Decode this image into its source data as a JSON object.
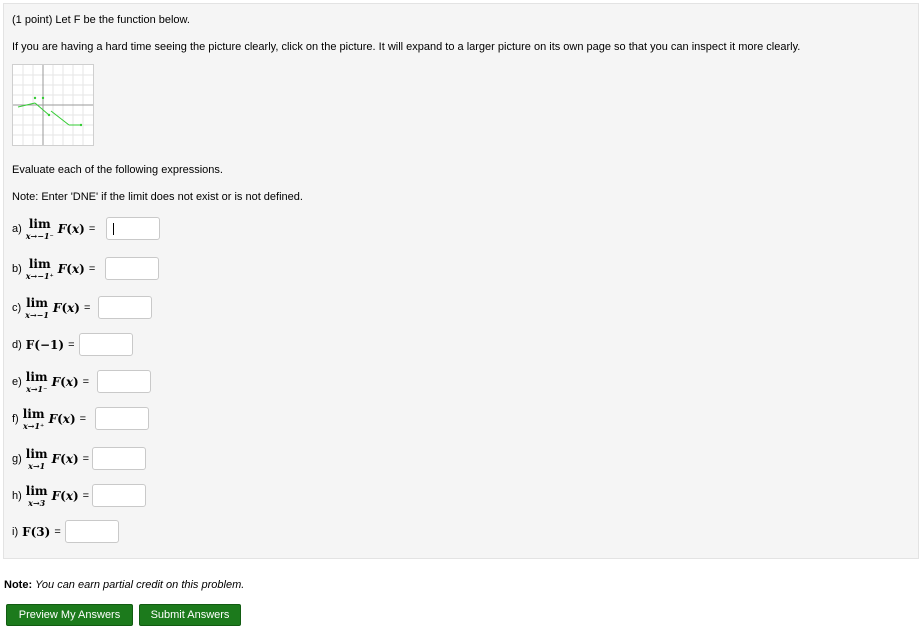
{
  "problem": {
    "header": "(1 point) Let F be the function below.",
    "picture_hint": "If you are having a hard time seeing the picture clearly, click on the picture. It will expand to a larger picture on its own page so that you can inspect it more clearly.",
    "evaluate": "Evaluate each of the following expressions.",
    "note": "Note: Enter 'DNE' if the limit does not exist or is not defined."
  },
  "questions": [
    {
      "label": "a)",
      "kind": "lim",
      "sub": "x→−1⁻",
      "f": "F",
      "var": "x",
      "value": ""
    },
    {
      "label": "b)",
      "kind": "lim",
      "sub": "x→−1⁺",
      "f": "F",
      "var": "x",
      "value": ""
    },
    {
      "label": "c)",
      "kind": "lim",
      "sub": "x→−1",
      "f": "F",
      "var": "x",
      "value": ""
    },
    {
      "label": "d)",
      "kind": "val",
      "expr": "F(−1)",
      "value": ""
    },
    {
      "label": "e)",
      "kind": "lim",
      "sub": "x→1⁻",
      "f": "F",
      "var": "x",
      "value": ""
    },
    {
      "label": "f)",
      "kind": "lim",
      "sub": "x→1⁺",
      "f": "F",
      "var": "x",
      "value": ""
    },
    {
      "label": "g)",
      "kind": "lim",
      "sub": "x→1",
      "f": "F",
      "var": "x",
      "value": ""
    },
    {
      "label": "h)",
      "kind": "lim",
      "sub": "x→3",
      "f": "F",
      "var": "x",
      "value": ""
    },
    {
      "label": "i)",
      "kind": "val",
      "expr": "F(3)",
      "value": ""
    }
  ],
  "lim_word": "lim",
  "equals": "=",
  "footer": {
    "note_bold": "Note:",
    "note_text": "You can earn partial credit on this problem."
  },
  "buttons": {
    "preview": "Preview My Answers",
    "submit": "Submit Answers"
  },
  "colors": {
    "button_green": "#1c7a1c",
    "graph_line": "#33cc33",
    "panel_bg": "#f5f5f5"
  }
}
